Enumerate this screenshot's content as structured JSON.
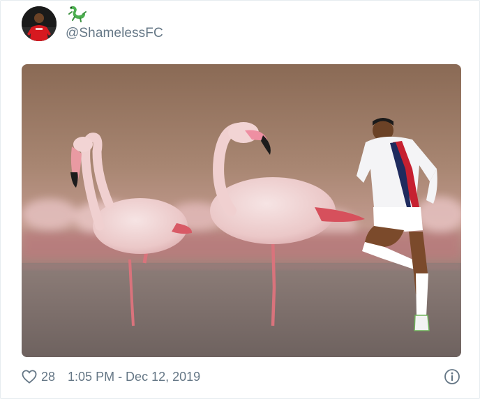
{
  "tweet": {
    "author": {
      "handle": "@ShamelessFC",
      "avatar_icon": "footballer-avatar",
      "name_icon": "lizard-icon"
    },
    "media": {
      "subject": "flamingos-with-footballer-photo"
    },
    "footer": {
      "like_icon": "heart-icon",
      "like_count": "28",
      "timestamp": "1:05 PM - Dec 12, 2019",
      "info_icon": "info-icon"
    }
  },
  "colors": {
    "handle": "#657786",
    "border": "#e6ecf0",
    "lizard": "#4caf50"
  }
}
